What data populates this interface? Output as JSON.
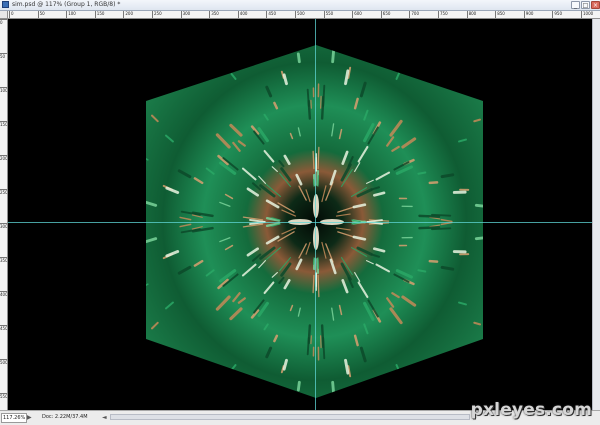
{
  "window": {
    "title": "sim.psd @ 117% (Group 1, RGB/8) *",
    "min_label": "_",
    "max_label": "□",
    "close_label": "×"
  },
  "ruler": {
    "h_labels": [
      "0",
      "50",
      "100",
      "150",
      "200",
      "250",
      "300",
      "350",
      "400",
      "450",
      "500",
      "550",
      "600",
      "650",
      "700",
      "750",
      "800",
      "850",
      "900",
      "950",
      "1000"
    ],
    "v_labels": [
      "0",
      "50",
      "100",
      "150",
      "200",
      "250",
      "300",
      "350",
      "400",
      "450",
      "500",
      "550"
    ]
  },
  "status": {
    "zoom": "117.26%",
    "doc_info": "Doc: 2.22M/37.4M",
    "arrow": "▶",
    "nav_left": "◄",
    "nav_right": "►"
  },
  "watermark": "pxleyes.com",
  "colors": {
    "canvas": "#000000",
    "guide": "#5fd6d6",
    "green_dark": "#0b3d24",
    "green": "#1f8f57",
    "tan": "#b57a4a"
  }
}
